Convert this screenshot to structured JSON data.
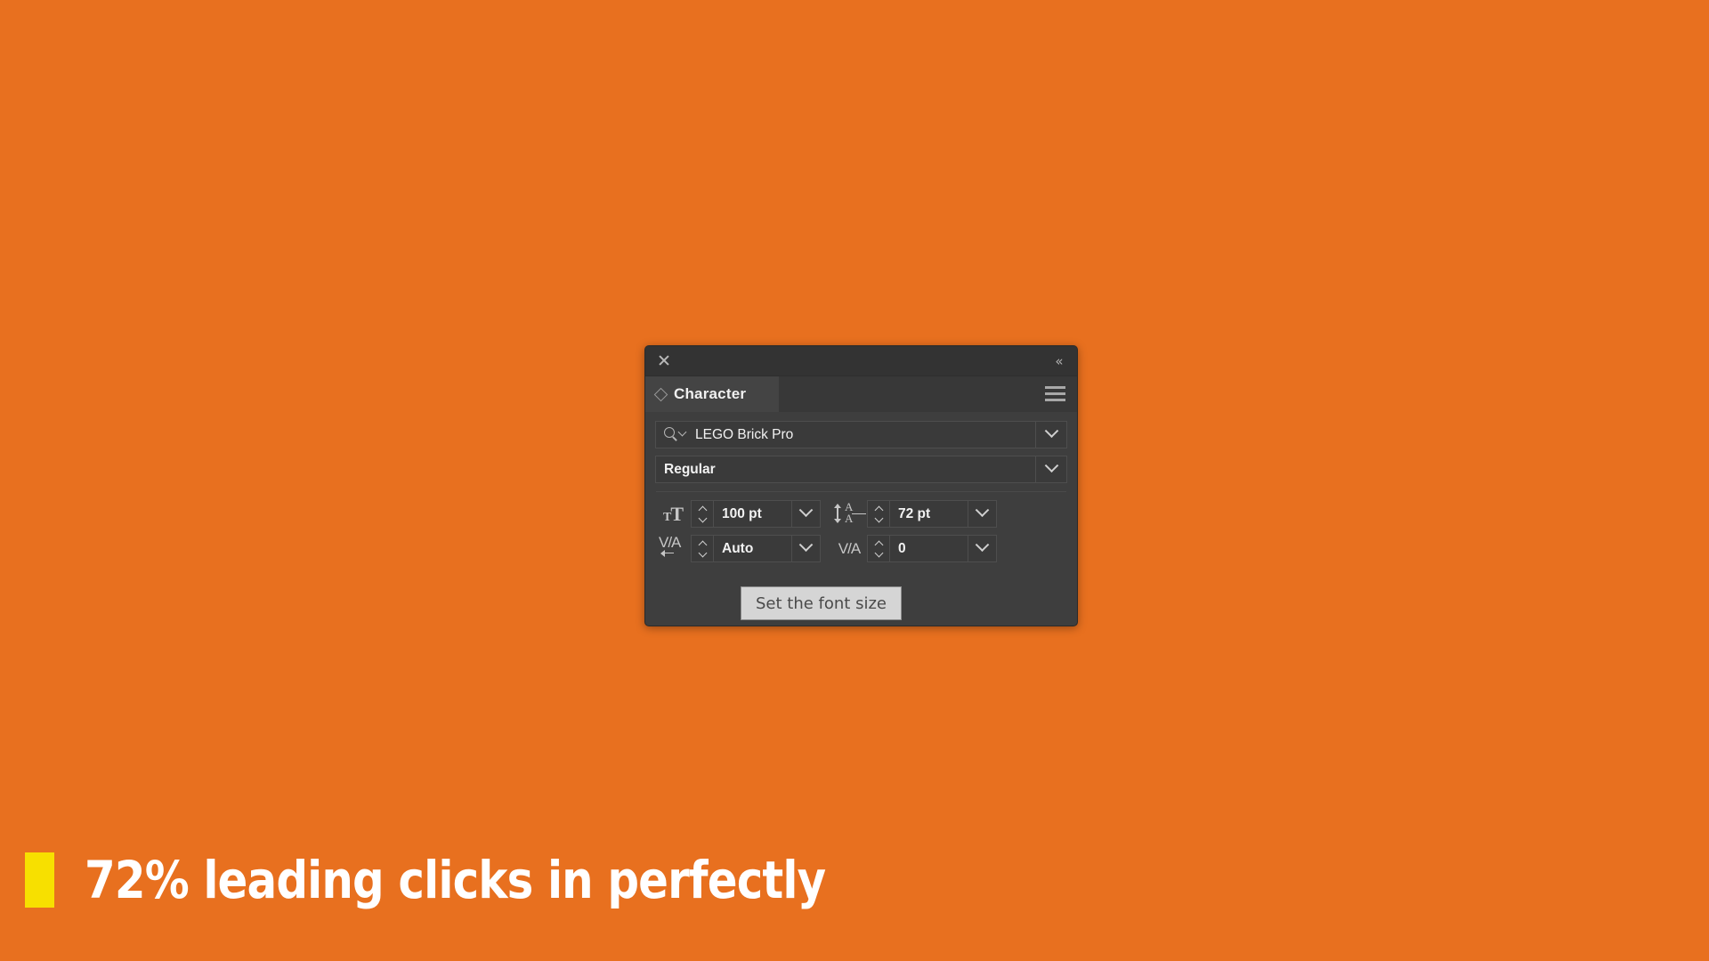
{
  "canvas": {
    "background_color": "#E8701F"
  },
  "panel": {
    "titlebar": {
      "close_icon": "close-icon",
      "collapse_label": "«",
      "collapse_icon": "collapse-double-chevron-icon"
    },
    "tab": {
      "diamond_icon": "diamond-icon",
      "label": "Character",
      "menu_icon": "hamburger-menu-icon"
    },
    "background_color": "#3E3E3E",
    "fields": {
      "font_family": {
        "search_icon": "search-icon",
        "value": "LEGO Brick Pro",
        "dropdown_icon": "chevron-down-icon"
      },
      "font_style": {
        "value": "Regular",
        "dropdown_icon": "chevron-down-icon"
      },
      "font_size": {
        "icon": "font-size-icon",
        "icon_small": "T",
        "icon_large": "T",
        "value": "100 pt",
        "stepper_icon": "stepper-updown-icon",
        "dropdown_icon": "chevron-down-icon"
      },
      "leading": {
        "icon": "leading-icon",
        "glyph_top": "A",
        "glyph_bottom": "A",
        "value": "72 pt",
        "stepper_icon": "stepper-updown-icon",
        "dropdown_icon": "chevron-down-icon"
      },
      "kerning": {
        "icon": "kerning-icon",
        "icon_glyph": "V/A",
        "value": "Auto",
        "stepper_icon": "stepper-updown-icon",
        "dropdown_icon": "chevron-down-icon"
      },
      "tracking": {
        "icon": "tracking-icon",
        "icon_glyph": "V/A",
        "value": "0",
        "stepper_icon": "stepper-updown-icon",
        "dropdown_icon": "chevron-down-icon"
      }
    }
  },
  "tooltip": {
    "text": "Set the font size",
    "background_color": "#D5D5D5",
    "text_color": "#4A4A4A"
  },
  "caption": {
    "marker_color": "#F7E000",
    "text": "72% leading clicks in perfectly",
    "text_color": "#FFFFFF"
  }
}
